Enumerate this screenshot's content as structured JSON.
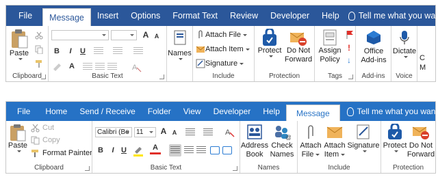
{
  "ribbon_top": {
    "tabs": [
      "File",
      "Message",
      "Insert",
      "Options",
      "Format Text",
      "Review",
      "Developer",
      "Help"
    ],
    "active_tab": "Message",
    "tell_me": "Tell me what you want to do",
    "groups": {
      "clipboard": {
        "label": "Clipboard",
        "paste": "Paste"
      },
      "basic_text": {
        "label": "Basic Text",
        "grow": "A",
        "shrink": "A",
        "bold": "B",
        "italic": "I",
        "underline": "U",
        "font_color": "A"
      },
      "names": {
        "label": "Names"
      },
      "include": {
        "label": "Include",
        "attach_file": "Attach File",
        "attach_item": "Attach Item",
        "signature": "Signature"
      },
      "protection": {
        "label": "Protection",
        "protect": "Protect",
        "do_not_forward_1": "Do Not",
        "do_not_forward_2": "Forward"
      },
      "tags": {
        "label": "Tags",
        "assign_policy_1": "Assign",
        "assign_policy_2": "Policy"
      },
      "addins": {
        "label": "Add-ins",
        "office_addins_1": "Office",
        "office_addins_2": "Add-ins"
      },
      "voice": {
        "label": "Voice",
        "dictate": "Dictate"
      },
      "cut_label": "C",
      "cut_label2": "M"
    }
  },
  "ribbon_bottom": {
    "tabs": [
      "File",
      "Home",
      "Send / Receive",
      "Folder",
      "View",
      "Developer",
      "Help",
      "Message"
    ],
    "active_tab": "Message",
    "tell_me": "Tell me what you want to do",
    "groups": {
      "clipboard": {
        "label": "Clipboard",
        "paste": "Paste",
        "cut": "Cut",
        "copy": "Copy",
        "format_painter": "Format Painter"
      },
      "basic_text": {
        "label": "Basic Text",
        "font": "Calibri (Bo",
        "size": "11",
        "grow": "A",
        "shrink": "A",
        "bold": "B",
        "italic": "I",
        "underline": "U",
        "font_color": "A"
      },
      "names": {
        "label": "Names",
        "address_book_1": "Address",
        "address_book_2": "Book",
        "check_names_1": "Check",
        "check_names_2": "Names"
      },
      "include": {
        "label": "Include",
        "attach_file_1": "Attach",
        "attach_file_2": "File",
        "attach_item_1": "Attach",
        "attach_item_2": "Item",
        "signature": "Signature"
      },
      "protection": {
        "label": "Protection",
        "protect": "Protect",
        "do_not_forward_1": "Do Not",
        "do_not_forward_2": "Forward"
      }
    }
  },
  "colors": {
    "tab_bar_top": "#2b579a",
    "tab_bar_bottom": "#2672c5",
    "accent": "#2b579a",
    "protect_blue": "#1e5aa8",
    "envelope": "#f0b35a",
    "no_red": "#d9412b",
    "flag_red": "#e0302a"
  }
}
